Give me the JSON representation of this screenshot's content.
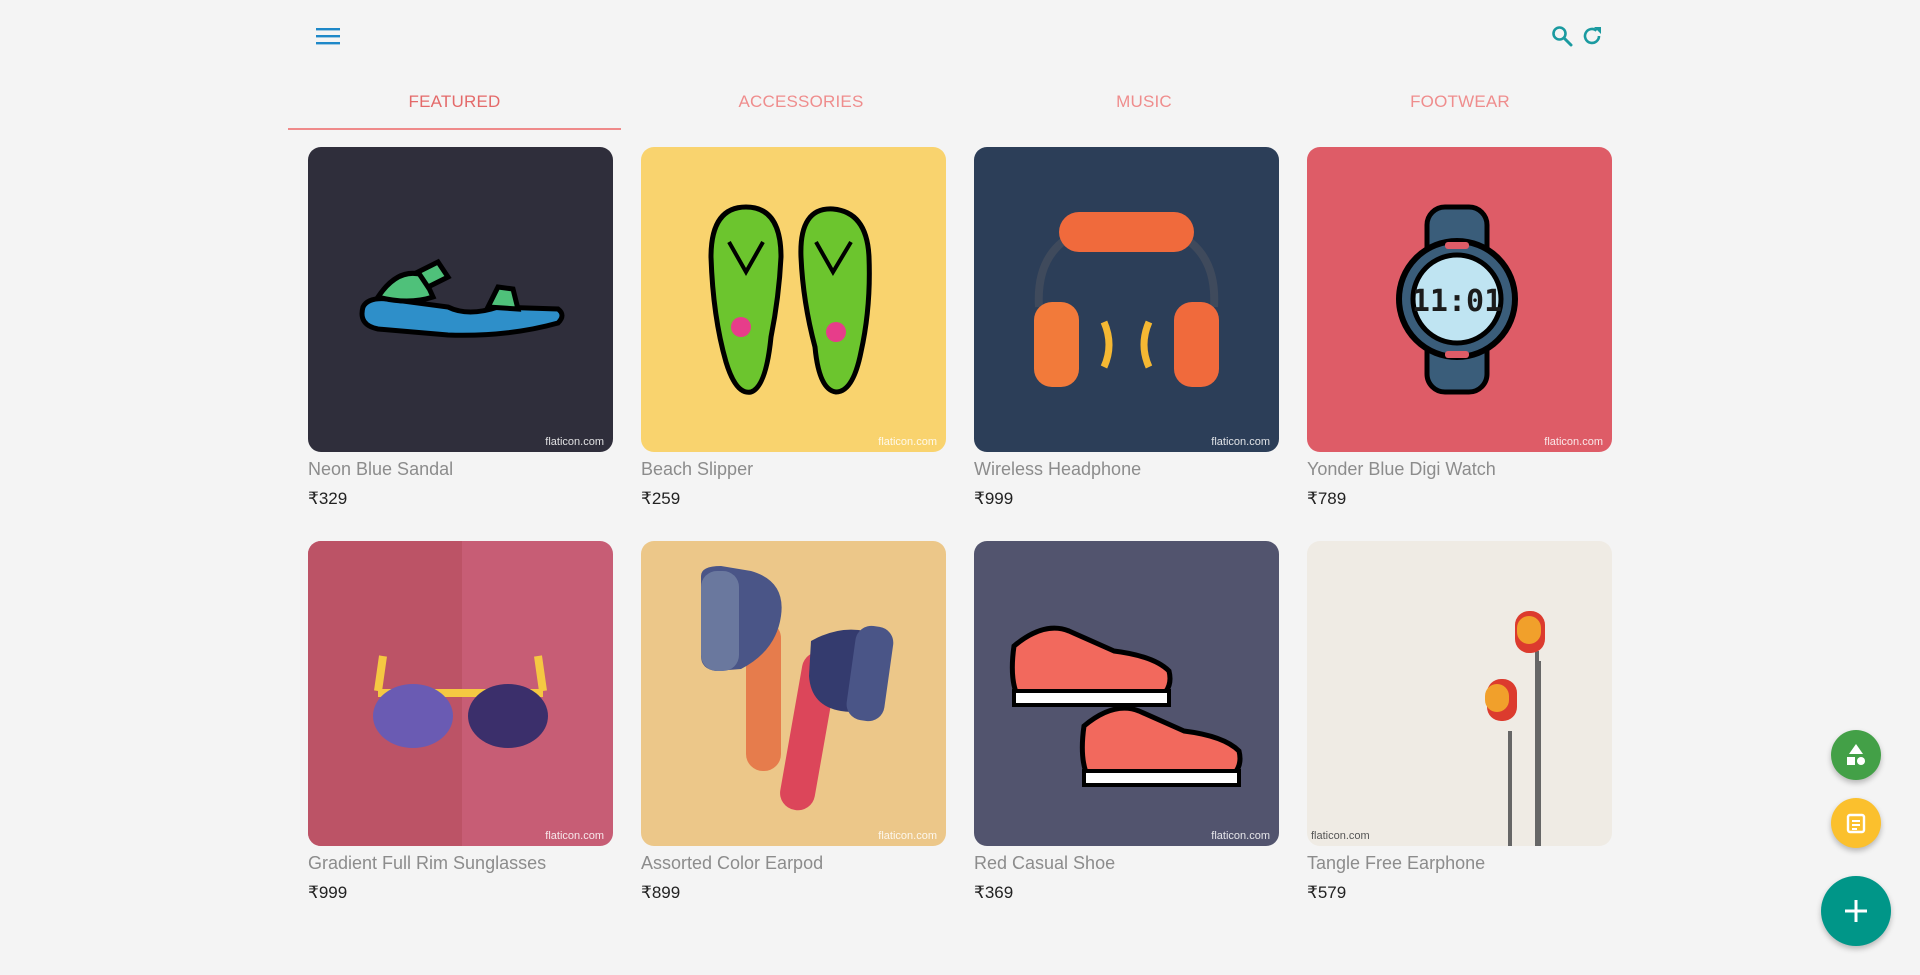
{
  "header": {
    "menu_icon": "hamburger-menu-icon",
    "search_icon": "search-icon",
    "refresh_icon": "refresh-icon"
  },
  "tabs": [
    {
      "label": "FEATURED",
      "active": true
    },
    {
      "label": "ACCESSORIES",
      "active": false
    },
    {
      "label": "MUSIC",
      "active": false
    },
    {
      "label": "FOOTWEAR",
      "active": false
    }
  ],
  "products": [
    {
      "name": "Neon Blue Sandal",
      "price": "₹329",
      "bg": "#2f2e3b",
      "watermark": "flaticon.com"
    },
    {
      "name": "Beach Slipper",
      "price": "₹259",
      "bg": "#f9d36e",
      "watermark": "flaticon.com"
    },
    {
      "name": "Wireless Headphone",
      "price": "₹999",
      "bg": "#2c3e58",
      "watermark": "flaticon.com"
    },
    {
      "name": "Yonder Blue Digi Watch",
      "price": "₹789",
      "bg": "#de5c67",
      "watermark": "flaticon.com",
      "watch_time": "11:01"
    },
    {
      "name": "Gradient Full Rim Sunglasses",
      "price": "₹999",
      "bg": "#c75d75",
      "watermark": "flaticon.com"
    },
    {
      "name": "Assorted Color Earpod",
      "price": "₹899",
      "bg": "#ecc789",
      "watermark": "flaticon.com"
    },
    {
      "name": "Red Casual Shoe",
      "price": "₹369",
      "bg": "#52546e",
      "watermark": "flaticon.com"
    },
    {
      "name": "Tangle Free Earphone",
      "price": "₹579",
      "bg": "#efebe4",
      "watermark": "flaticon.com"
    }
  ],
  "fabs": {
    "shapes_icon": "shapes-icon",
    "notes_icon": "notes-icon",
    "add_icon": "plus-icon"
  },
  "colors": {
    "accent": "#1e88c8",
    "tab_text": "#ef8d8d",
    "fab_green": "#43a047",
    "fab_yellow": "#fbc02d",
    "fab_teal": "#009688"
  }
}
